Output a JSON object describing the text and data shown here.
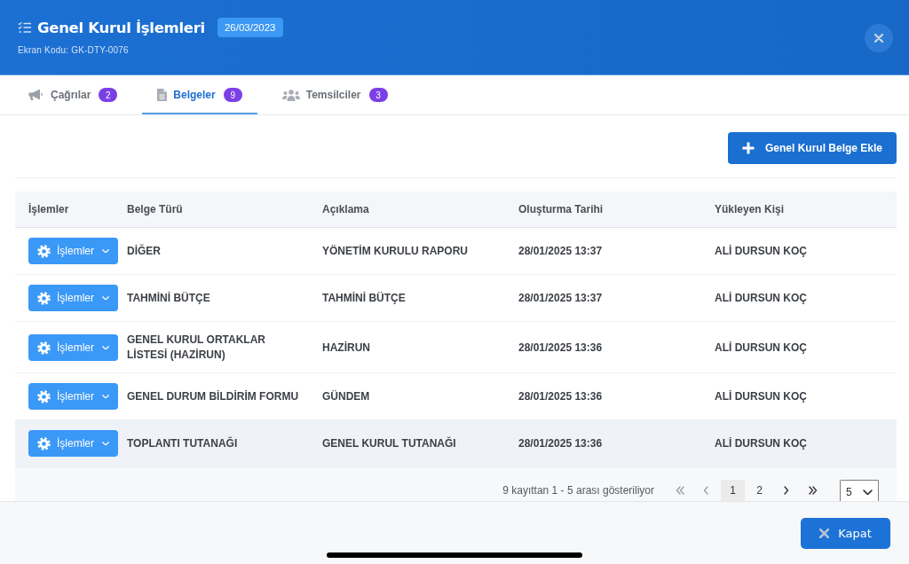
{
  "header": {
    "title": "Genel Kurul İşlemleri",
    "date_badge": "26/03/2023",
    "screen_code": "Ekran Kodu: GK-DTY-0076"
  },
  "tabs": [
    {
      "label": "Çağrılar",
      "count": "2",
      "selected": false
    },
    {
      "label": "Belgeler",
      "count": "9",
      "selected": true
    },
    {
      "label": "Temsilciler",
      "count": "3",
      "selected": false
    }
  ],
  "toolbar": {
    "add_button": "Genel Kurul Belge Ekle"
  },
  "table": {
    "columns": [
      "İşlemler",
      "Belge Türü",
      "Açıklama",
      "Oluşturma Tarihi",
      "Yükleyen Kişi"
    ],
    "rows": [
      {
        "actions": "İşlemler",
        "document_type": "DİĞER",
        "description": "YÖNETİM KURULU RAPORU",
        "created_at": "28/01/2025 13:37",
        "uploaded_by": "ALİ DURSUN KOÇ",
        "highlighted": false
      },
      {
        "actions": "İşlemler",
        "document_type": "TAHMİNİ BÜTÇE",
        "description": "TAHMİNİ BÜTÇE",
        "created_at": "28/01/2025 13:37",
        "uploaded_by": "ALİ DURSUN KOÇ",
        "highlighted": false
      },
      {
        "actions": "İşlemler",
        "document_type": "GENEL KURUL ORTAKLAR LİSTESİ (HAZİRUN)",
        "description": "HAZİRUN",
        "created_at": "28/01/2025 13:36",
        "uploaded_by": "ALİ DURSUN KOÇ",
        "highlighted": false
      },
      {
        "actions": "İşlemler",
        "document_type": "GENEL DURUM BİLDİRİM FORMU",
        "description": "GÜNDEM",
        "created_at": "28/01/2025 13:36",
        "uploaded_by": "ALİ DURSUN KOÇ",
        "highlighted": false
      },
      {
        "actions": "İşlemler",
        "document_type": "TOPLANTI TUTANAĞI",
        "description": "GENEL KURUL TUTANAĞI",
        "created_at": "28/01/2025 13:36",
        "uploaded_by": "ALİ DURSUN KOÇ",
        "highlighted": true
      }
    ]
  },
  "pagination": {
    "summary": "9 kayıttan 1 - 5 arası gösteriliyor",
    "first": {
      "disabled": true
    },
    "previous": {
      "disabled": true
    },
    "pages": [
      {
        "label": "1",
        "selected": true
      },
      {
        "label": "2",
        "selected": false
      }
    ],
    "next": {
      "disabled": false
    },
    "last": {
      "disabled": false
    },
    "page_size": "5"
  },
  "footer": {
    "close_button": "Kapat"
  }
}
